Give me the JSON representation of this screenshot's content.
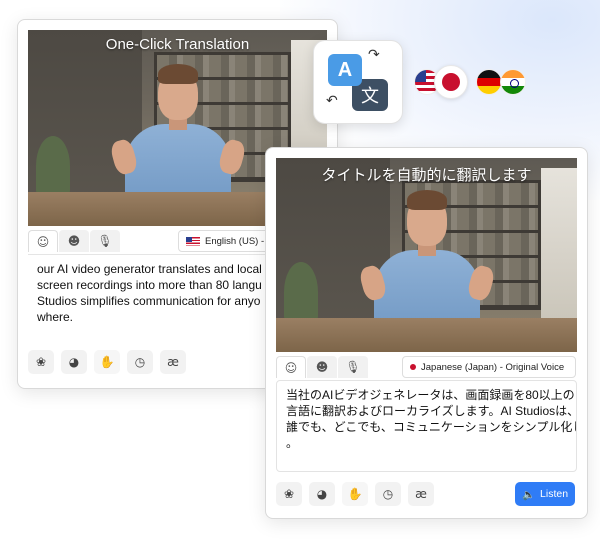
{
  "card_en": {
    "caption": "One-Click Translation",
    "tabs": [
      "person-icon",
      "group-icon",
      "mic-icon"
    ],
    "language": "English (US) - O",
    "text_lines": [
      "our AI video generator translates and local",
      "screen recordings into more than 80 langu",
      "Studios simplifies communication for anyo",
      "where."
    ],
    "tools": [
      "voice-icon",
      "speed-icon",
      "gesture-icon",
      "clock-icon",
      "ae-icon"
    ],
    "ae_label": "æ"
  },
  "card_jp": {
    "caption": "タイトルを自動的に翻訳します",
    "language": "Japanese (Japan)  - Original Voice",
    "text_lines": [
      "当社のAIビデオジェネレータは、画面録画を80以上の",
      "言語に翻訳およびローカライズします。AI Studiosは、",
      "誰でも、どこでも、コミュニケーションをシンプル化します",
      "。"
    ],
    "ae_label": "æ",
    "listen_label": "Listen"
  },
  "translate_badge": {
    "a": "A",
    "b": "文"
  },
  "flags": [
    "us",
    "jp",
    "de",
    "in"
  ],
  "colors": {
    "accent": "#2f7cf6",
    "badge_a": "#4a9be6",
    "badge_b": "#3d4f63"
  }
}
